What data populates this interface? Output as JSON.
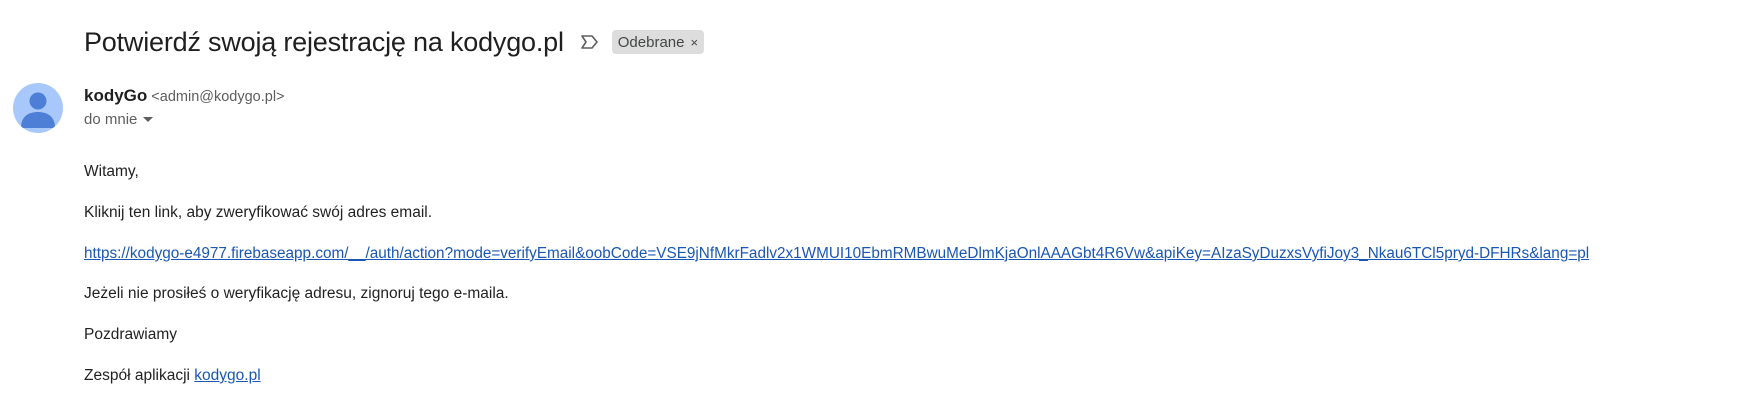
{
  "email": {
    "subject": "Potwierdź swoją rejestrację na kodygo.pl",
    "label": "Odebrane",
    "label_close": "×",
    "sender": {
      "name": "kodyGo",
      "email": "<admin@kodygo.pl>"
    },
    "recipient": "do mnie",
    "body": {
      "greeting": "Witamy,",
      "instruction": "Kliknij ten link, aby zweryfikować swój adres email.",
      "verify_link": "https://kodygo-e4977.firebaseapp.com/__/auth/action?mode=verifyEmail&oobCode=VSE9jNfMkrFadlv2x1WMUI10EbmRMBwuMeDlmKjaOnlAAAGbt4R6Vw&apiKey=AIzaSyDuzxsVyfiJoy3_Nkau6TCl5pryd-DFHRs&lang=pl",
      "ignore_note": "Jeżeli nie prosiłeś o weryfikację adresu, zignoruj tego e-maila.",
      "regards": "Pozdrawiamy",
      "team_prefix": "Zespół aplikacji ",
      "team_link": "kodygo.pl"
    }
  },
  "colors": {
    "link": "#1a57b4",
    "avatar_bg": "#a8c7fa",
    "avatar_fg": "#4d7fd6",
    "chip_bg": "#dddddd"
  },
  "icons": {
    "important_marker": "label-important-outline-icon",
    "avatar": "person-icon",
    "recipient_caret": "caret-down-icon"
  }
}
